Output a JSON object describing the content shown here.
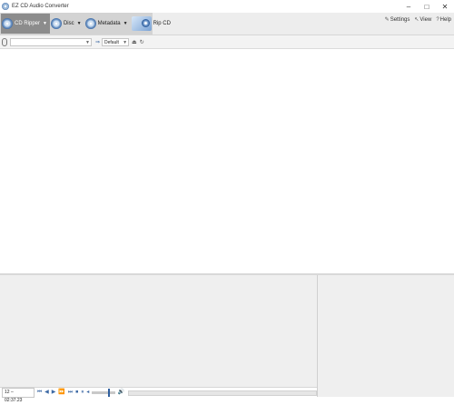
{
  "window": {
    "title": "EZ CD Audio Converter",
    "controls": [
      "–",
      "□",
      "✕"
    ]
  },
  "ribbon": {
    "cd_ripper_label": "CD Ripper",
    "disc_label": "Disc",
    "metadata_label": "Metadata",
    "rip_cd_label": "Rip CD",
    "settings_label": "Settings",
    "view_label": "View",
    "help_label": "Help"
  },
  "toolbar": {
    "drive_value": "",
    "profile_value": "Default"
  },
  "player": {
    "time_display": "12 – 02:37.23"
  },
  "colors": {
    "accent": "#3e6aa5",
    "ribbon_active": "#8c8c8c"
  }
}
